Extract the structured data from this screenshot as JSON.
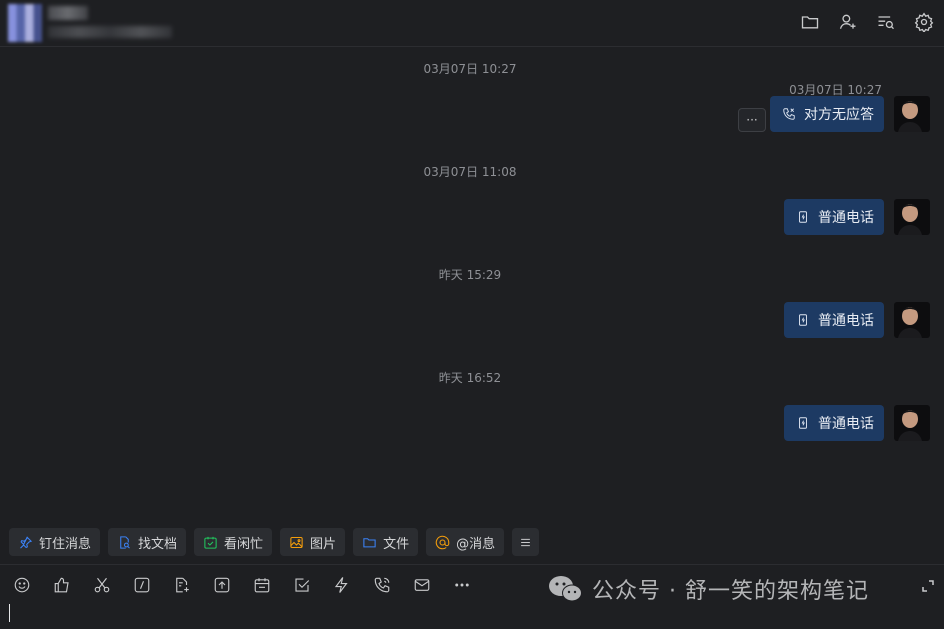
{
  "header": {
    "icons": [
      "folder-icon",
      "add-user-icon",
      "search-history-icon",
      "settings-icon"
    ]
  },
  "messages": [
    {
      "timestamp": "03月07日 10:27",
      "bubble_time": "03月07日 10:27",
      "text": "对方无应答",
      "icon": "phone-missed-icon",
      "more": "···"
    },
    {
      "timestamp": "03月07日 11:08",
      "text": "普通电话",
      "icon": "phone-call-icon"
    },
    {
      "timestamp": "昨天 15:29",
      "text": "普通电话",
      "icon": "phone-call-icon"
    },
    {
      "timestamp": "昨天 16:52",
      "text": "普通电话",
      "icon": "phone-call-icon"
    }
  ],
  "quick_actions": [
    {
      "label": "钉住消息",
      "icon": "pin-icon",
      "color": "#3b82f6"
    },
    {
      "label": "找文档",
      "icon": "find-doc-icon",
      "color": "#3b82f6"
    },
    {
      "label": "看闲忙",
      "icon": "calendar-check-icon",
      "color": "#22c55e"
    },
    {
      "label": "图片",
      "icon": "image-icon",
      "color": "#f59e0b"
    },
    {
      "label": "文件",
      "icon": "folder-icon",
      "color": "#3b82f6"
    },
    {
      "label": "@消息",
      "icon": "at-icon",
      "color": "#f59e0b"
    },
    {
      "label": "",
      "icon": "menu-icon",
      "color": "#c9cacc"
    }
  ],
  "toolbar": {
    "icons": [
      "emoji-icon",
      "thumbs-up-icon",
      "scissors-icon",
      "slash-command-icon",
      "doc-add-icon",
      "upload-icon",
      "calendar-icon",
      "checkbox-icon",
      "lightning-icon",
      "phone-icon",
      "mail-icon",
      "more-icon"
    ]
  },
  "watermark": {
    "text": "公众号 · 舒一笑的架构笔记"
  }
}
